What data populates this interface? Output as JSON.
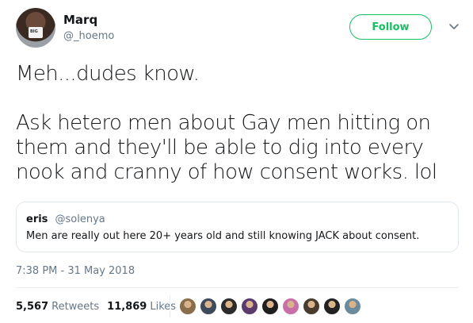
{
  "author": {
    "display_name": "Marq",
    "handle": "@_hoemo",
    "avatar_mug_text": "BIG"
  },
  "follow_button": {
    "label": "Follow"
  },
  "tweet": {
    "line1": "Meh...dudes know.",
    "line2": "Ask hetero men about Gay men hitting on them and they'll be able to dig into every nook and cranny of how consent works. lol"
  },
  "quoted_tweet": {
    "name": "eris",
    "handle": "@solenya",
    "text": "Men are really out here 20+ years old and still knowing JACK about consent."
  },
  "timestamp": "7:38 PM - 31 May 2018",
  "stats": {
    "retweets_count": "5,567",
    "retweets_label": "Retweets",
    "likes_count": "11,869",
    "likes_label": "Likes"
  },
  "likers": [
    {
      "icon": "liker-avatar",
      "color": "#8a6d4b"
    },
    {
      "icon": "liker-avatar",
      "color": "#3d4a5c"
    },
    {
      "icon": "liker-avatar",
      "color": "#2b2b2b"
    },
    {
      "icon": "liker-avatar",
      "color": "#5b3a6e"
    },
    {
      "icon": "liker-avatar",
      "color": "#1f1f1f"
    },
    {
      "icon": "liker-avatar",
      "color": "#c86fa8"
    },
    {
      "icon": "liker-avatar",
      "color": "#4a3b2f"
    },
    {
      "icon": "liker-avatar",
      "color": "#222222"
    },
    {
      "icon": "liker-avatar",
      "color": "#6b8a9c"
    }
  ],
  "colors": {
    "follow_accent": "#17bf63",
    "secondary_text": "#657786",
    "primary_text": "#14171a",
    "border": "#e1e8ed"
  }
}
